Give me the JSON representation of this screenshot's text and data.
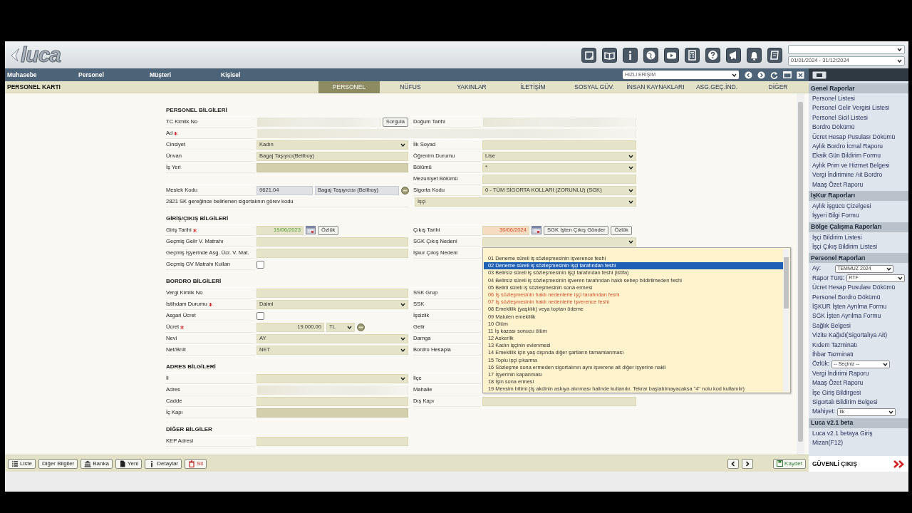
{
  "header": {
    "logo": "luca",
    "period": "01/01/2024 - 31/12/2024"
  },
  "menu": {
    "items": [
      "Muhasebe",
      "Personel",
      "Müşteri",
      "Kişisel"
    ],
    "quick_access": "HIZLI ERİŞİM"
  },
  "page": {
    "title": "PERSONEL KARTI",
    "tabs": [
      {
        "label": "PERSONEL",
        "selected": true
      },
      {
        "label": "NÜFUS",
        "selected": false
      },
      {
        "label": "YAKINLAR",
        "selected": false
      },
      {
        "label": "İLETİŞİM",
        "selected": false
      },
      {
        "label": "SOSYAL GÜV.",
        "selected": false
      },
      {
        "label": "İNSAN KAYNAKLARI",
        "selected": false
      },
      {
        "label": "ASG.GEÇ.İND.",
        "selected": false
      },
      {
        "label": "DİĞER",
        "selected": false
      }
    ]
  },
  "sections": [
    {
      "title": "PERSONEL BİLGİLERİ",
      "rows": [
        {
          "left": {
            "label": "TC Kimlik No",
            "required": false,
            "field": {
              "kind": "blurred",
              "buttons": [
                "Sorgula"
              ]
            }
          },
          "right": {
            "label": "Doğum Tarihi",
            "field": {
              "kind": "blurred"
            }
          }
        },
        {
          "left": {
            "label": "Ad",
            "required": true,
            "field": {
              "kind": "blurred",
              "wide": true
            }
          }
        },
        {
          "left": {
            "label": "Cinsiyet",
            "required": false,
            "field": {
              "kind": "select",
              "value": "Kadın"
            }
          },
          "right": {
            "label": "İlk Soyad",
            "field": {
              "kind": "text",
              "disabled": false
            }
          }
        },
        {
          "left": {
            "label": "Ünvan",
            "required": false,
            "field": {
              "kind": "text",
              "value": "Bagaj Taşıyıcı(Bellboy)",
              "disabled": false
            }
          },
          "right": {
            "label": "Öğrenim Durumu",
            "field": {
              "kind": "select",
              "value": "Lise"
            }
          }
        },
        {
          "left": {
            "label": "İş Yeri",
            "required": false,
            "field": {
              "kind": "text",
              "disabled": true
            }
          },
          "right": {
            "label": "Bölümü",
            "field": {
              "kind": "select",
              "value": "*"
            }
          }
        },
        {
          "right": {
            "label": "Mezuniyet Bölümü",
            "field": {
              "kind": "text",
              "disabled": false
            }
          }
        },
        {
          "left": {
            "label": "Meslek Kodu",
            "required": false,
            "field": {
              "kind": "code",
              "code": "9621.04",
              "description": "Bagaj Taşıyıcısı (Bellboy)"
            }
          },
          "right": {
            "label": "Sigorta Kodu",
            "field": {
              "kind": "select",
              "value": "0 - TÜM SİGORTA KOLLARI (ZORUNLU) (SGK)"
            }
          }
        },
        {
          "left": {
            "label": "2821 SK gereğince belirlenen sigortalının görev kodu",
            "required": false,
            "wide": true
          },
          "right": {
            "field": {
              "kind": "select",
              "value": "İşçi",
              "wide": true
            }
          }
        }
      ]
    },
    {
      "title": "GİRİŞ/ÇIKIŞ BİLGİLERİ",
      "rows": [
        {
          "left": {
            "label": "Giriş Tarihi",
            "required": true,
            "field": {
              "kind": "date",
              "value": "19/06/2023",
              "overdue": false,
              "buttons": [
                "Özlük"
              ]
            }
          },
          "right": {
            "label": "Çıkış Tarihi",
            "field": {
              "kind": "date",
              "value": "30/06/2024",
              "overdue": true,
              "buttons": [
                "SGK İşten Çıkış Gönder",
                "Özlük"
              ]
            }
          }
        },
        {
          "left": {
            "label": "Geçmiş Gelir V. Matrahı",
            "required": false,
            "field": {
              "kind": "text",
              "disabled": false
            }
          },
          "right": {
            "label": "SGK Çıkış Nedeni",
            "field": {
              "kind": "select",
              "open": true,
              "options": [
                {
                  "label": "01 Deneme süreli iş sözleşmesinin işverence feshi",
                  "selected": false,
                  "warning": false
                },
                {
                  "label": "02 Deneme süreli iş sözleşmesinin işçi tarafından feshi",
                  "selected": true,
                  "warning": false
                },
                {
                  "label": "03 Belirsiz süreli iş sözleşmesinin işçi tarafından feshi (istifa)",
                  "selected": false,
                  "warning": false
                },
                {
                  "label": "04 Belirsiz süreli iş sözleşmesinin işveren tarafından haklı sebep bildirilmeden feshi",
                  "selected": false,
                  "warning": false
                },
                {
                  "label": "05 Belirli süreli iş sözleşmesinin sona ermesi",
                  "selected": false,
                  "warning": false
                },
                {
                  "label": "06 İş sözleşmesinin haklı nedenlerle işçi tarafından feshi",
                  "selected": false,
                  "warning": true
                },
                {
                  "label": "07 İş sözleşmesinin haklı nedenlerle işverence feshi",
                  "selected": false,
                  "warning": true
                },
                {
                  "label": "08 Emeklilik (yaşlılık) veya toptan ödeme",
                  "selected": false,
                  "warning": false
                },
                {
                  "label": "09 Malulen emeklilik",
                  "selected": false,
                  "warning": false
                },
                {
                  "label": "10 Ölüm",
                  "selected": false,
                  "warning": false
                },
                {
                  "label": "11 İş kazası sonucu ölüm",
                  "selected": false,
                  "warning": false
                },
                {
                  "label": "12 Askerlik",
                  "selected": false,
                  "warning": false
                },
                {
                  "label": "13 Kadın işçinin evlenmesi",
                  "selected": false,
                  "warning": false
                },
                {
                  "label": "14 Emeklilik için yaş dışında diğer şartların tamamlanması",
                  "selected": false,
                  "warning": false
                },
                {
                  "label": "15 Toplu işçi çıkarma",
                  "selected": false,
                  "warning": false
                },
                {
                  "label": "16 Sözleşme sona ermeden sigortalının aynı işverene ait diğer işyerine nakli",
                  "selected": false,
                  "warning": false
                },
                {
                  "label": "17 İşyerinin kapanması",
                  "selected": false,
                  "warning": false
                },
                {
                  "label": "18 İşin sona ermesi",
                  "selected": false,
                  "warning": false
                },
                {
                  "label": "19 Mevsim bitimi (İş akdinin askıya alınması halinde kullanılır. Tekrar başlatılmayacaksa \"4\" nolu kod kullanılır)",
                  "selected": false,
                  "warning": false
                }
              ]
            }
          }
        },
        {
          "left": {
            "label": "Geçmiş İşyerinde Asg. Ücr. V. Mat.",
            "required": false,
            "field": {
              "kind": "text",
              "disabled": false
            }
          },
          "right": {
            "label": "İşkur Çıkış Nedeni"
          }
        },
        {
          "left": {
            "label": "Geçmiş GV Matrahı Kullan",
            "required": false,
            "field": {
              "kind": "checkbox",
              "checked": false
            }
          }
        }
      ]
    },
    {
      "title": "BORDRO BİLGİLERİ",
      "rows": [
        {
          "left": {
            "label": "Vergi Kimlik No",
            "required": false,
            "field": {
              "kind": "text",
              "disabled": false
            }
          },
          "right": {
            "label": "SSK Grup"
          }
        },
        {
          "left": {
            "label": "İstihdam Durumu",
            "required": true,
            "field": {
              "kind": "select",
              "value": "Daimi"
            }
          },
          "right": {
            "label": "SSK"
          }
        },
        {
          "left": {
            "label": "Asgari Ücret",
            "required": false,
            "field": {
              "kind": "checkbox",
              "checked": false
            }
          },
          "right": {
            "label": "İşsizlik"
          }
        },
        {
          "left": {
            "label": "Ücret",
            "required": true,
            "field": {
              "kind": "money",
              "value": "19.000,00",
              "currency": "TL"
            }
          },
          "right": {
            "label": "Gelir"
          }
        },
        {
          "left": {
            "label": "Nevi",
            "required": false,
            "field": {
              "kind": "select",
              "value": "AY"
            }
          },
          "right": {
            "label": "Damga"
          }
        },
        {
          "left": {
            "label": "Net/Brüt",
            "required": false,
            "field": {
              "kind": "select",
              "value": "NET"
            }
          },
          "right": {
            "label": "Bordro Hesapla"
          }
        }
      ]
    },
    {
      "title": "ADRES BİLGİLERİ",
      "rows": [
        {
          "left": {
            "label": "İl",
            "required": false,
            "field": {
              "kind": "select"
            }
          },
          "right": {
            "label": "İlçe"
          }
        },
        {
          "left": {
            "label": "Adres",
            "required": false,
            "field": {
              "kind": "blurred"
            }
          },
          "right": {
            "label": "Mahalle"
          }
        },
        {
          "left": {
            "label": "Cadde",
            "required": false,
            "field": {
              "kind": "text",
              "disabled": false
            }
          },
          "right": {
            "label": "Dış Kapı",
            "field": {
              "kind": "text",
              "disabled": false
            }
          }
        },
        {
          "left": {
            "label": "İç Kapı",
            "required": false,
            "field": {
              "kind": "text",
              "disabled": true
            }
          }
        }
      ]
    },
    {
      "title": "DİĞER BİLGİLER",
      "rows": [
        {
          "left": {
            "label": "KEP Adresi",
            "required": false,
            "field": {
              "kind": "text",
              "disabled": false
            }
          }
        }
      ]
    }
  ],
  "toolbar": {
    "buttons": [
      {
        "label": "Liste",
        "danger": false
      },
      {
        "label": "Diğer Bilgiler",
        "danger": false
      },
      {
        "label": "Banka",
        "danger": false
      },
      {
        "label": "Yeni",
        "danger": false
      },
      {
        "label": "Detaylar",
        "danger": false
      },
      {
        "label": "Sil",
        "danger": true
      }
    ],
    "save": "Kaydet"
  },
  "sidebar": {
    "sections": [
      {
        "title": "Genel Raporlar",
        "items": [
          {
            "kind": "link",
            "label": "Personel Listesi"
          },
          {
            "kind": "link",
            "label": "Personel Gelir Vergisi Listesi"
          },
          {
            "kind": "link",
            "label": "Personel Sicil Listesi"
          },
          {
            "kind": "link",
            "label": "Bordro Dökümü"
          },
          {
            "kind": "link",
            "label": "Ücret Hesap Pusulası Dökümü"
          },
          {
            "kind": "link",
            "label": "Aylık Bordro İcmal Raporu"
          },
          {
            "kind": "link",
            "label": "Eksik Gün Bildirim Formu"
          },
          {
            "kind": "link",
            "label": "Aylık Prim ve Hizmet Belgesi"
          },
          {
            "kind": "link",
            "label": "Vergi İndirimine Ait Bordro"
          },
          {
            "kind": "link",
            "label": "Maaş Özet Raporu"
          }
        ]
      },
      {
        "title": "İşKur Raporları",
        "items": [
          {
            "kind": "link",
            "label": "Aylık İşgücü Çizelgesi"
          },
          {
            "kind": "link",
            "label": "İşyeri Bilgi Formu"
          }
        ]
      },
      {
        "title": "Bölge Çalışma Raporları",
        "items": [
          {
            "kind": "link",
            "label": "İşçi Bildirim Listesi"
          },
          {
            "kind": "link",
            "label": "İşçi Çıkış Bildirim Listesi"
          }
        ]
      },
      {
        "title": "Personel Raporları",
        "items": [
          {
            "kind": "select",
            "label": "Ay:",
            "value": "TEMMUZ 2024"
          },
          {
            "kind": "select",
            "label": "Rapor Türü:",
            "value": "RTF"
          },
          {
            "kind": "link",
            "label": "Ücret Hesap Pusulası Dökümü"
          },
          {
            "kind": "link",
            "label": "Personel Bordro Dökümü"
          },
          {
            "kind": "link",
            "label": "İŞKUR İşten Ayrılma Formu"
          },
          {
            "kind": "link",
            "label": "SGK İşten Ayrılma Formu"
          },
          {
            "kind": "link",
            "label": "Sağlık Belgesi"
          },
          {
            "kind": "link",
            "label": "Vizite Kağıdı(Sigortalıya Ait)"
          },
          {
            "kind": "link",
            "label": "Kıdem Tazminatı"
          },
          {
            "kind": "link",
            "label": "İhbar Tazminatı"
          },
          {
            "kind": "select",
            "label": "Özlük:",
            "value": "-- Seçiniz --"
          },
          {
            "kind": "link",
            "label": "Vergi İndirimi Raporu"
          },
          {
            "kind": "link",
            "label": "Maaş Özet Raporu"
          },
          {
            "kind": "link",
            "label": "İşe Giriş Bildirgesi"
          },
          {
            "kind": "link",
            "label": "Sigortalı Bildirim Belgesi"
          },
          {
            "kind": "select",
            "label": "Mahiyet:",
            "value": "İlk"
          }
        ]
      },
      {
        "title": "Luca v2.1 beta",
        "items": [
          {
            "kind": "link",
            "label": "Luca v2.1 betaya Giriş"
          },
          {
            "kind": "link",
            "label": "Mizan(F12)"
          }
        ]
      }
    ],
    "logout": "GÜVENLİ ÇIKIŞ"
  }
}
